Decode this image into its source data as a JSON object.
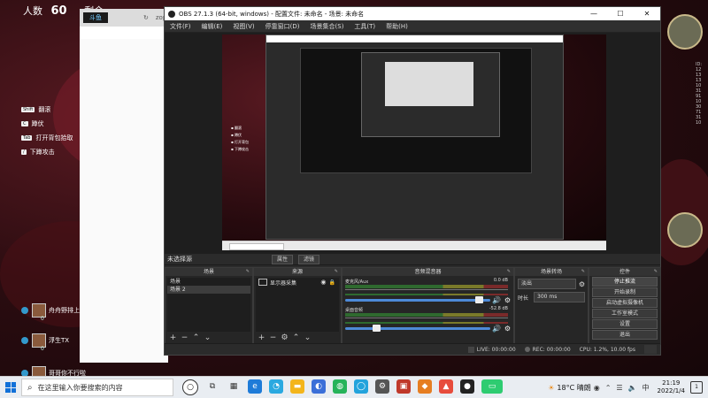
{
  "game": {
    "people_label": "人数",
    "people_count": "60",
    "remaining_text": "剩余",
    "menu": [
      {
        "key": "Shift",
        "label": "翻滚"
      },
      {
        "key": "C",
        "label": "蹲伏"
      },
      {
        "key": "Tab",
        "label": "打开背包拾取"
      },
      {
        "key": "/",
        "label": "下蹲攻击"
      }
    ],
    "players": [
      {
        "name": "舟舟野排上…",
        "count": "0"
      },
      {
        "name": "浮生TX",
        "count": "0"
      },
      {
        "name": "哥哥你不行啦",
        "count": ""
      }
    ],
    "side_text": "ID:1213131031911030713110"
  },
  "browser": {
    "tab_text": "zop",
    "field": "学"
  },
  "obs": {
    "title": "OBS 27.1.3 (64-bit, windows) - 配置文件: 未命名 - 场景: 未命名",
    "menu": [
      "文件(F)",
      "编辑(E)",
      "视图(V)",
      "停靠窗口(D)",
      "场景集合(S)",
      "工具(T)",
      "帮助(H)"
    ],
    "window_controls": {
      "minimize": "—",
      "maximize": "☐",
      "close": "✕"
    },
    "toolbar": {
      "no_source": "未选择源",
      "properties": "属性",
      "filters": "滤镜"
    },
    "docks": {
      "scenes": {
        "title": "场景",
        "items": [
          "场景",
          "场景 2"
        ],
        "selected": 1
      },
      "sources": {
        "title": "来源",
        "items": [
          {
            "label": "显示器采集"
          }
        ]
      },
      "mixer": {
        "title": "音频混音器",
        "channels": [
          {
            "name": "麦克风/Aux",
            "db": "0.0 dB",
            "slider": 0.95
          },
          {
            "name": "桌面音频",
            "db": "-52.8 dB",
            "slider": 0.2
          }
        ]
      },
      "transitions": {
        "title": "场景转场",
        "type": "淡出",
        "duration_label": "时长",
        "duration": "300 ms"
      },
      "controls": {
        "title": "控件",
        "buttons": [
          "停止推流",
          "开始录制",
          "启动虚拟摄像机",
          "工作室模式",
          "设置",
          "退出"
        ]
      }
    },
    "status": {
      "live": "LIVE: 00:00:00",
      "rec": "REC: 00:00:00",
      "cpu": "CPU: 1.2%, 10.00 fps"
    }
  },
  "taskbar": {
    "search_placeholder": "在这里输入你要搜索的内容",
    "weather": "18°C 晴朗",
    "ime": "中",
    "time": "21:19",
    "date": "2022/1/4",
    "notif": "1"
  }
}
